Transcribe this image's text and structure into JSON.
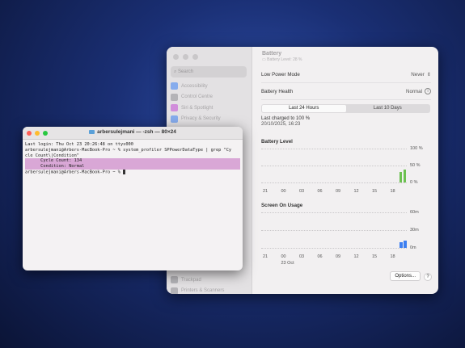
{
  "settings": {
    "title": "Battery",
    "subtitle": "Battery Level: 28 %",
    "search_placeholder": "Search",
    "sidebar_items": [
      {
        "label": "Accessibility",
        "color": "#3b82f6"
      },
      {
        "label": "Control Centre",
        "color": "#8e8e93"
      },
      {
        "label": "Siri & Spotlight",
        "color": "#c24bd6"
      },
      {
        "label": "Privacy & Security",
        "color": "#3b82f6"
      }
    ],
    "sidebar_bottom": [
      {
        "label": "Trackpad",
        "color": "#8e8e93"
      },
      {
        "label": "Printers & Scanners",
        "color": "#8e8e93"
      }
    ],
    "low_power_label": "Low Power Mode",
    "low_power_value": "Never",
    "health_label": "Battery Health",
    "health_value": "Normal",
    "tabs": [
      "Last 24 Hours",
      "Last 10 Days"
    ],
    "charged_label": "Last charged to 100 %",
    "charged_date": "20/10/2025, 16:23",
    "battery_chart": {
      "title": "Battery Level",
      "y_ticks": [
        "100 %",
        "50 %",
        "0 %"
      ],
      "x_ticks": [
        "21",
        "00",
        "03",
        "06",
        "09",
        "12",
        "15",
        "18"
      ],
      "bars_percent": [
        30,
        38
      ]
    },
    "screen_chart": {
      "title": "Screen On Usage",
      "y_ticks": [
        "60m",
        "30m",
        "0m"
      ],
      "x_ticks": [
        "21",
        "00",
        "03",
        "06",
        "09",
        "12",
        "15",
        "18"
      ],
      "date_label": "23 Oct",
      "bars_minutes": [
        10,
        12
      ]
    },
    "options_label": "Options...",
    "help_label": "?"
  },
  "terminal": {
    "title": "arbersulejmani — -zsh — 80×24",
    "lines": [
      "Last login: Thu Oct 23 20:26:48 on ttys000",
      "arbersulejmani@Arbers-MacBook-Pro ~ % system_profiler SPPowerDataType | grep \"Cy",
      "cle Count\\|Condition\"",
      "      Cycle Count: 134",
      "      Condition: Normal",
      "arbersulejmani@Arbers-MacBook-Pro ~ % "
    ],
    "dot_colors": [
      "#ff5f57",
      "#febc2e",
      "#28c840"
    ]
  }
}
